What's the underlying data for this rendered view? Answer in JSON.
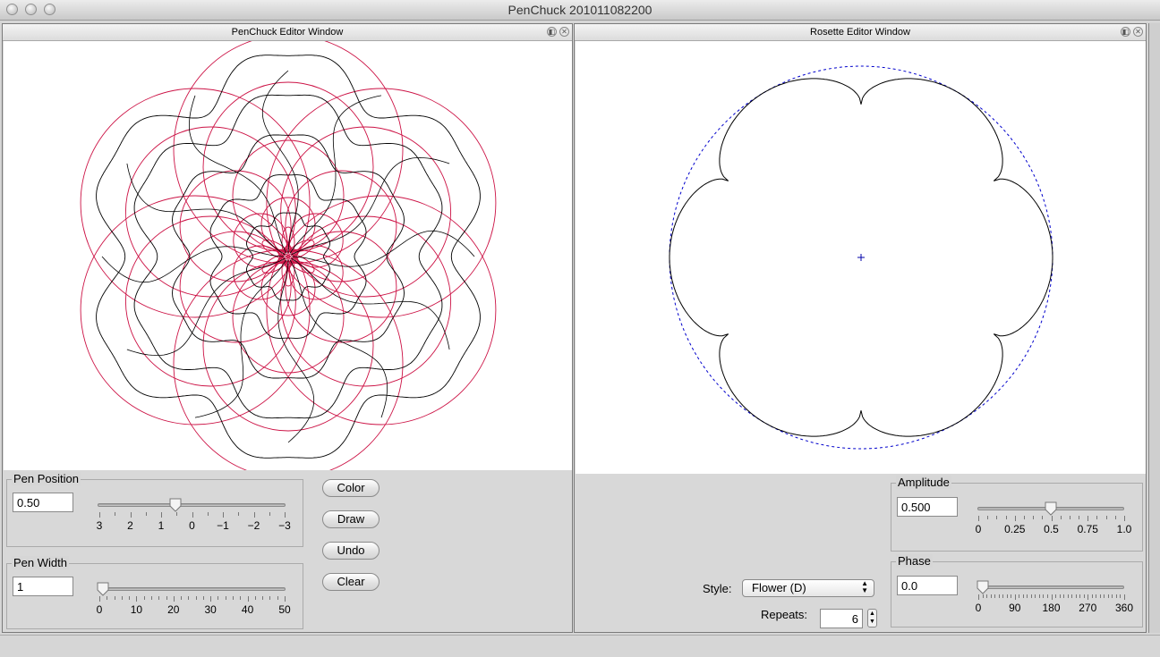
{
  "app": {
    "title": "PenChuck 201011082200"
  },
  "left_window": {
    "title": "PenChuck Editor Window",
    "pen_position": {
      "label": "Pen Position",
      "value": "0.50",
      "slider_value": 0.5,
      "ticks": [
        "3",
        "2",
        "1",
        "0",
        "−1",
        "−2",
        "−3"
      ]
    },
    "pen_width": {
      "label": "Pen Width",
      "value": "1",
      "slider_value": 1,
      "ticks": [
        "0",
        "10",
        "20",
        "30",
        "40",
        "50"
      ]
    },
    "buttons": {
      "color": "Color",
      "draw": "Draw",
      "undo": "Undo",
      "clear": "Clear"
    },
    "drawing_colors": {
      "star": "#000000",
      "rings": "#cc1144"
    }
  },
  "right_window": {
    "title": "Rosette Editor Window",
    "amplitude": {
      "label": "Amplitude",
      "value": "0.500",
      "slider_value": 0.5,
      "ticks": [
        "0",
        "0.25",
        "0.5",
        "0.75",
        "1.0"
      ]
    },
    "phase": {
      "label": "Phase",
      "value": "0.0",
      "slider_value": 0,
      "ticks": [
        "0",
        "90",
        "180",
        "270",
        "360"
      ]
    },
    "style": {
      "label": "Style:",
      "selected": "Flower (D)"
    },
    "repeats": {
      "label": "Repeats:",
      "value": "6"
    },
    "colors": {
      "outline": "#000000",
      "guide_circle": "#0000cc",
      "center": "#0000aa"
    }
  }
}
